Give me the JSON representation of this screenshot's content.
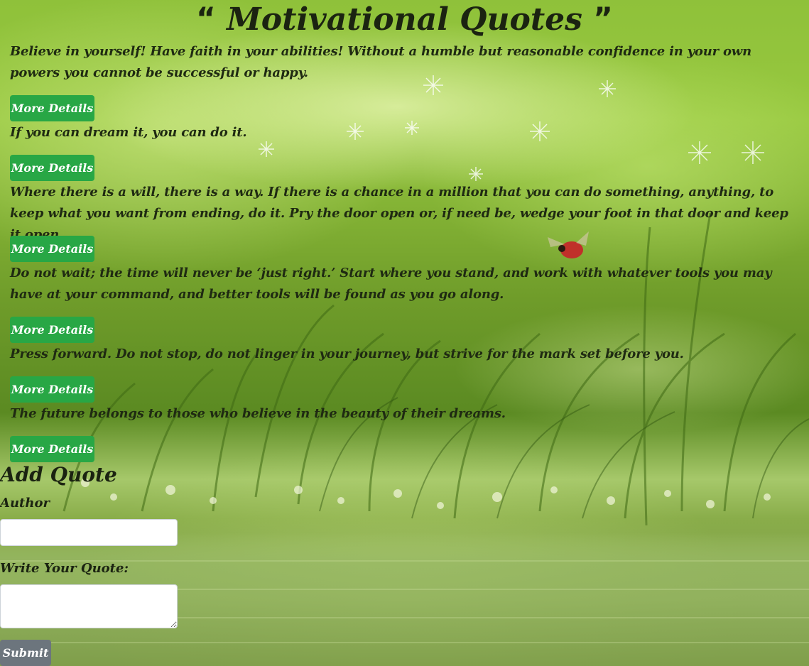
{
  "header": {
    "open_quote_icon": "“",
    "title": "Motivational Quotes",
    "close_quote_icon": "”"
  },
  "quotes": [
    {
      "text": "Believe in yourself! Have faith in your abilities! Without a humble but reasonable confidence in your own powers you cannot be successful or happy.",
      "button_label": "More Details"
    },
    {
      "text": "If you can dream it, you can do it.",
      "button_label": "More Details"
    },
    {
      "text": "Where there is a will, there is a way. If there is a chance in a million that you can do something, anything, to keep what you want from ending, do it. Pry the door open or, if need be, wedge your foot in that door and keep it open.",
      "button_label": "More Details"
    },
    {
      "text": "Do not wait; the time will never be ‘just right.’ Start where you stand, and work with whatever tools you may have at your command, and better tools will be found as you go along.",
      "button_label": "More Details"
    },
    {
      "text": "Press forward. Do not stop, do not linger in your journey, but strive for the mark set before you.",
      "button_label": "More Details"
    },
    {
      "text": "The future belongs to those who believe in the beauty of their dreams.",
      "button_label": "More Details"
    }
  ],
  "form": {
    "title": "Add Quote",
    "author_label": "Author",
    "author_value": "",
    "author_placeholder": "",
    "quote_label": "Write Your Quote:",
    "quote_value": "",
    "quote_placeholder": "",
    "submit_label": "Submit"
  },
  "colors": {
    "button_primary": "#28a745",
    "button_secondary": "#6c757d",
    "text": "#1f2a12"
  },
  "background_icon": "green-meadow-dandelion-ladybug-background"
}
